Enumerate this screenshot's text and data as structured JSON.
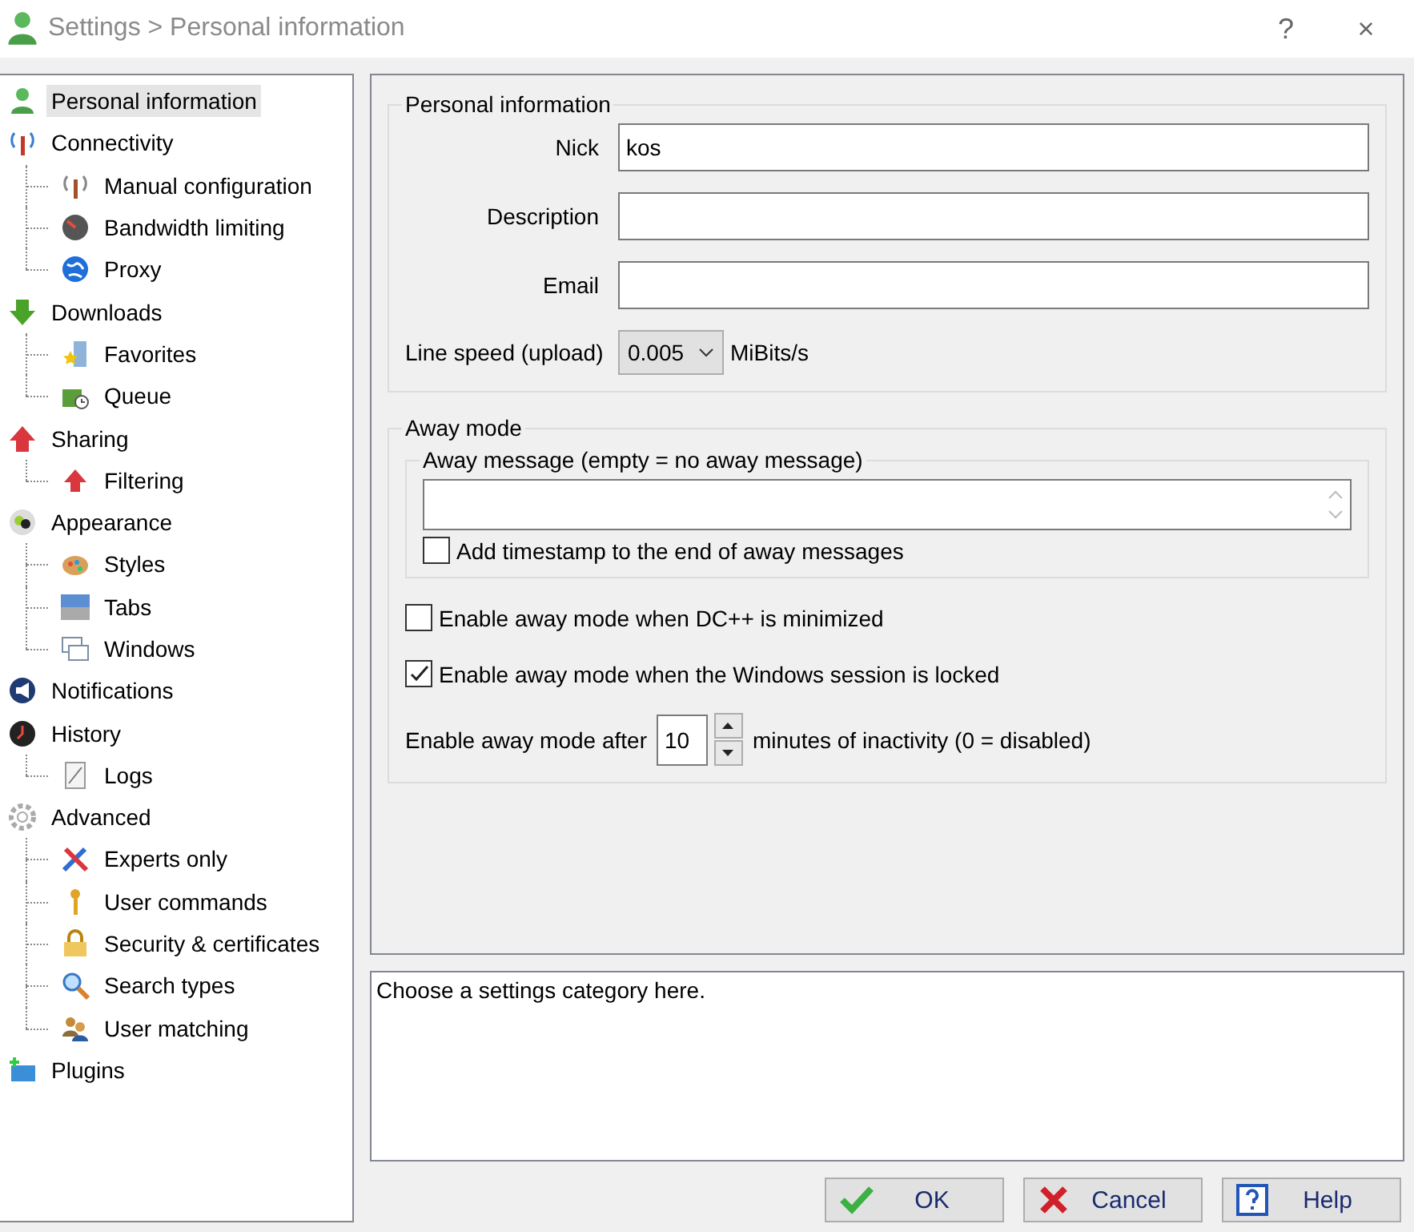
{
  "window": {
    "title": "Settings > Personal information",
    "help": "?",
    "close": "×"
  },
  "tree": [
    {
      "label": "Personal information",
      "selected": true
    },
    {
      "label": "Connectivity",
      "selected": false,
      "children": [
        {
          "label": "Manual configuration",
          "selected": false
        },
        {
          "label": "Bandwidth limiting",
          "selected": false
        },
        {
          "label": "Proxy",
          "selected": false
        }
      ]
    },
    {
      "label": "Downloads",
      "selected": false,
      "children": [
        {
          "label": "Favorites",
          "selected": false
        },
        {
          "label": "Queue",
          "selected": false
        }
      ]
    },
    {
      "label": "Sharing",
      "selected": false,
      "children": [
        {
          "label": "Filtering",
          "selected": false
        }
      ]
    },
    {
      "label": "Appearance",
      "selected": false,
      "children": [
        {
          "label": "Styles",
          "selected": false
        },
        {
          "label": "Tabs",
          "selected": false
        },
        {
          "label": "Windows",
          "selected": false
        }
      ]
    },
    {
      "label": "Notifications",
      "selected": false
    },
    {
      "label": "History",
      "selected": false,
      "children": [
        {
          "label": "Logs",
          "selected": false
        }
      ]
    },
    {
      "label": "Advanced",
      "selected": false,
      "children": [
        {
          "label": "Experts only",
          "selected": false
        },
        {
          "label": "User commands",
          "selected": false
        },
        {
          "label": "Security & certificates",
          "selected": false
        },
        {
          "label": "Search types",
          "selected": false
        },
        {
          "label": "User matching",
          "selected": false
        }
      ]
    },
    {
      "label": "Plugins",
      "selected": false
    }
  ],
  "personal": {
    "title": "Personal information",
    "fields": [
      {
        "label": "Nick",
        "value": "kos"
      },
      {
        "label": "Description"
      },
      {
        "label": "Email"
      }
    ],
    "line_speed": {
      "label": "Line speed (upload)",
      "value": "0.005",
      "unit": "MiBits/s"
    }
  },
  "away": {
    "title": "Away mode",
    "message_group": "Away message (empty = no away message)",
    "timestamp": {
      "label": "Add timestamp to the end of away messages",
      "checked": false
    },
    "options": [
      {
        "label": "Enable away mode when DC++ is minimized",
        "checked": false
      },
      {
        "label": "Enable away mode when the Windows session is locked",
        "checked": true
      }
    ],
    "after": {
      "label": "Enable away mode after",
      "value": "10",
      "suffix": "minutes of inactivity (0 = disabled)"
    }
  },
  "description": "Choose a settings category here.",
  "buttons": [
    {
      "kind": "ok",
      "label": "OK"
    },
    {
      "kind": "cancel",
      "label": "Cancel"
    },
    {
      "kind": "help",
      "label": "Help"
    }
  ]
}
